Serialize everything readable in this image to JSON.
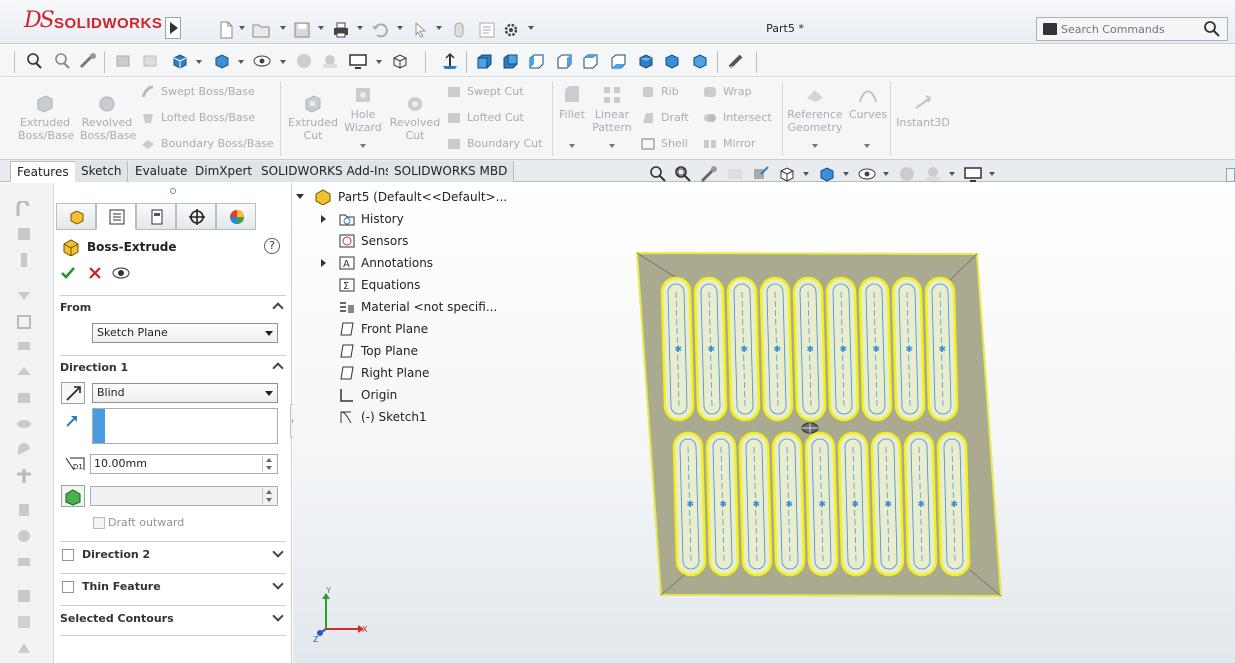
{
  "app": {
    "brand": "SOLIDWORKS",
    "document_title": "Part5 *",
    "search_placeholder": "Search Commands"
  },
  "command_manager": {
    "extrude_group": [
      {
        "label": "Extruded\nBoss/Base",
        "icon": "extruded-boss-icon"
      },
      {
        "label": "Revolved\nBoss/Base",
        "icon": "revolved-boss-icon"
      }
    ],
    "boss_small": [
      "Swept Boss/Base",
      "Lofted Boss/Base",
      "Boundary Boss/Base"
    ],
    "cut_group": [
      {
        "label": "Extruded\nCut",
        "icon": "extruded-cut-icon"
      },
      {
        "label": "Hole\nWizard",
        "icon": "hole-wizard-icon"
      },
      {
        "label": "Revolved\nCut",
        "icon": "revolved-cut-icon"
      }
    ],
    "cut_small": [
      "Swept Cut",
      "Lofted Cut",
      "Boundary Cut"
    ],
    "fillet": "Fillet",
    "linear_pattern": "Linear\nPattern",
    "features_small_a": [
      "Rib",
      "Draft",
      "Shell"
    ],
    "features_small_b": [
      "Wrap",
      "Intersect",
      "Mirror"
    ],
    "reference_geometry": "Reference\nGeometry",
    "curves": "Curves",
    "instant3d": "Instant3D"
  },
  "tabs": [
    "Features",
    "Sketch",
    "Evaluate",
    "DimXpert",
    "SOLIDWORKS Add-Ins",
    "SOLIDWORKS MBD"
  ],
  "active_tab": "Features",
  "property_manager": {
    "title": "Boss-Extrude",
    "help": "?",
    "from": {
      "heading": "From",
      "value": "Sketch Plane"
    },
    "direction1": {
      "heading": "Direction 1",
      "end_condition": "Blind",
      "depth": "10.00mm",
      "draft_outward": "Draft outward"
    },
    "direction2": {
      "heading": "Direction 2"
    },
    "thin_feature": {
      "heading": "Thin Feature"
    },
    "selected_contours": {
      "heading": "Selected Contours"
    }
  },
  "feature_tree": {
    "root": "Part5  (Default<<Default>...",
    "items": [
      {
        "label": "History",
        "icon": "history-folder-icon",
        "expandable": true
      },
      {
        "label": "Sensors",
        "icon": "sensors-icon",
        "expandable": false
      },
      {
        "label": "Annotations",
        "icon": "annotations-icon",
        "expandable": true
      },
      {
        "label": "Equations",
        "icon": "equations-icon",
        "expandable": false
      },
      {
        "label": "Material <not specifi...",
        "icon": "material-icon",
        "expandable": false
      },
      {
        "label": "Front Plane",
        "icon": "plane-icon",
        "expandable": false
      },
      {
        "label": "Top Plane",
        "icon": "plane-icon",
        "expandable": false
      },
      {
        "label": "Right Plane",
        "icon": "plane-icon",
        "expandable": false
      },
      {
        "label": "Origin",
        "icon": "origin-icon",
        "expandable": false
      },
      {
        "label": "(-) Sketch1",
        "icon": "sketch-icon",
        "expandable": false
      }
    ]
  },
  "triad": {
    "x": "X",
    "y": "Y",
    "z": "Z"
  },
  "colors": {
    "brand_red": "#d2232a",
    "selection_yellow": "#f2f21a",
    "sketch_blue": "#3a8fd9",
    "part_face": "#a7a98f",
    "accept_green": "#1e9a1e",
    "cancel_red": "#d22020"
  }
}
